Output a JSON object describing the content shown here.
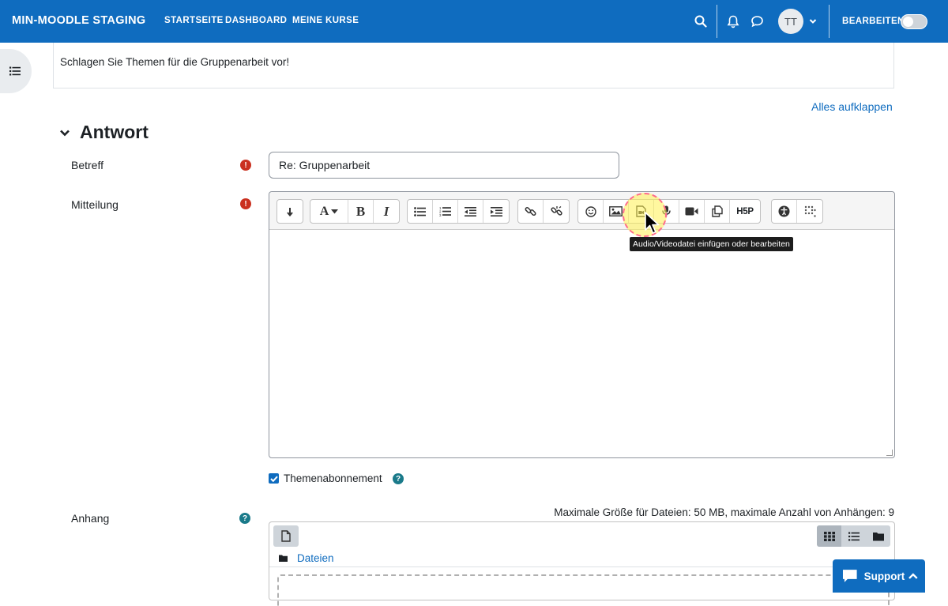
{
  "navbar": {
    "brand": "MIN-MOODLE STAGING",
    "links": [
      "STARTSEITE",
      "DASHBOARD",
      "MEINE KURSE"
    ],
    "avatar_initials": "TT",
    "edit_mode_label": "BEARBEITEN",
    "edit_mode_on": false,
    "bg_color": "#0f6cbf"
  },
  "post": {
    "text": "Schlagen Sie Themen für die Gruppenarbeit vor!"
  },
  "expand_all_label": "Alles aufklappen",
  "section": {
    "title": "Antwort"
  },
  "form": {
    "subject_label": "Betreff",
    "subject_value": "Re: Gruppenarbeit",
    "message_label": "Mitteilung",
    "subscribe_label": "Themenabonnement",
    "subscribe_checked": true,
    "attachment_label": "Anhang",
    "attachment_limits": "Maximale Größe für Dateien: 50 MB, maximale Anzahl von Anhängen: 9",
    "folder_name": "Dateien"
  },
  "editor_toolbar": {
    "tooltip": "Audio/Videodatei einfügen oder bearbeiten",
    "h5p_label": "H5P",
    "groups": [
      [
        "collapse-icon"
      ],
      [
        "font-style-icon",
        "bold-icon",
        "italic-icon"
      ],
      [
        "unordered-list-icon",
        "ordered-list-icon",
        "outdent-icon",
        "indent-icon"
      ],
      [
        "link-icon",
        "unlink-icon"
      ],
      [
        "emoji-icon",
        "image-icon",
        "media-icon",
        "record-audio-icon",
        "record-video-icon",
        "manage-files-icon",
        "h5p-icon"
      ],
      [
        "accessibility-checker-icon",
        "screenreader-helper-icon"
      ]
    ]
  },
  "support": {
    "label": "Support"
  },
  "colors": {
    "primary": "#0f6cbf",
    "required": "#ca3120",
    "highlight": "#fff050"
  }
}
